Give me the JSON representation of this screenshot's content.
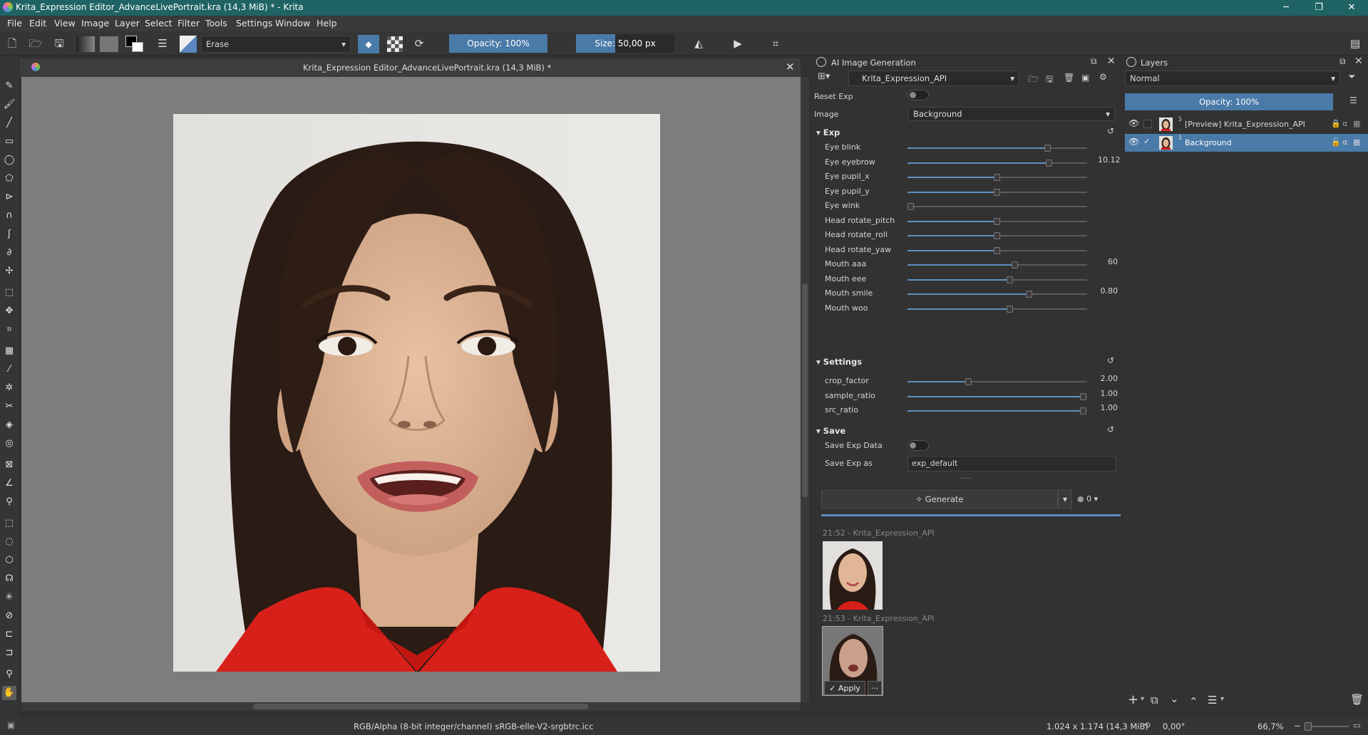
{
  "window": {
    "title": "Krita_Expression Editor_AdvanceLivePortrait.kra (14,3 MiB) * - Krita",
    "minimize": "─",
    "maximize": "❐",
    "close": "✕"
  },
  "menu": [
    "File",
    "Edit",
    "View",
    "Image",
    "Layer",
    "Select",
    "Filter",
    "Tools",
    "Settings",
    "Window",
    "Help"
  ],
  "toolbar": {
    "brush_preset": "Erase",
    "opacity": "Opacity: 100%",
    "size": "Size: 50,00 px"
  },
  "canvas": {
    "tab_title": "Krita_Expression Editor_AdvanceLivePortrait.kra (14,3 MiB) *",
    "close": "✕"
  },
  "ai_panel": {
    "title": "AI Image Generation",
    "workspace": "Krita_Expression_API",
    "reset_label": "Reset Exp",
    "image_label": "Image",
    "image_value": "Background",
    "sections": {
      "exp": "Exp",
      "settings": "Settings",
      "save": "Save"
    },
    "exp_params": [
      {
        "name": "Eye blink",
        "value": 0.78,
        "shown": ""
      },
      {
        "name": "Eye eyebrow",
        "value": 0.79,
        "shown": "10.12"
      },
      {
        "name": "Eye pupil_x",
        "value": 0.5,
        "shown": ""
      },
      {
        "name": "Eye pupil_y",
        "value": 0.5,
        "shown": ""
      },
      {
        "name": "Eye wink",
        "value": 0.0,
        "shown": ""
      },
      {
        "name": "Head rotate_pitch",
        "value": 0.5,
        "shown": ""
      },
      {
        "name": "Head rotate_roll",
        "value": 0.5,
        "shown": ""
      },
      {
        "name": "Head rotate_yaw",
        "value": 0.5,
        "shown": ""
      },
      {
        "name": "Mouth aaa",
        "value": 0.6,
        "shown": "60"
      },
      {
        "name": "Mouth eee",
        "value": 0.57,
        "shown": ""
      },
      {
        "name": "Mouth smile",
        "value": 0.68,
        "shown": "0.80"
      },
      {
        "name": "Mouth woo",
        "value": 0.57,
        "shown": ""
      }
    ],
    "settings_params": [
      {
        "name": "crop_factor",
        "value": 0.34,
        "shown": "2.00"
      },
      {
        "name": "sample_ratio",
        "value": 0.98,
        "shown": "1.00"
      },
      {
        "name": "src_ratio",
        "value": 0.98,
        "shown": "1.00"
      }
    ],
    "save_data_label": "Save Exp Data",
    "save_as_label": "Save Exp as",
    "save_as_value": "exp_default",
    "dots": "......",
    "generate": "Generate",
    "queue_count": "0",
    "history": [
      {
        "time": "21:52 - Krita_Expression_API"
      },
      {
        "time": "21:53 - Krita_Expression_API"
      }
    ],
    "apply": "Apply",
    "more": "···"
  },
  "layers_panel": {
    "title": "Layers",
    "blend": "Normal",
    "opacity": "Opacity:  100%",
    "layers": [
      {
        "name": "[Preview] Krita_Expression_API",
        "selected": false
      },
      {
        "name": "Background",
        "selected": true
      }
    ]
  },
  "status": {
    "color_space": "RGB/Alpha (8-bit integer/channel)  sRGB-elle-V2-srgbtrc.icc",
    "dimensions": "1.024 x 1.174 (14,3 MiB)",
    "rotation": "0,00°",
    "zoom": "66,7%"
  },
  "colors": {
    "accent": "#4a7aa8",
    "titlebar": "#1f6364",
    "shirt": "#d8201a"
  }
}
